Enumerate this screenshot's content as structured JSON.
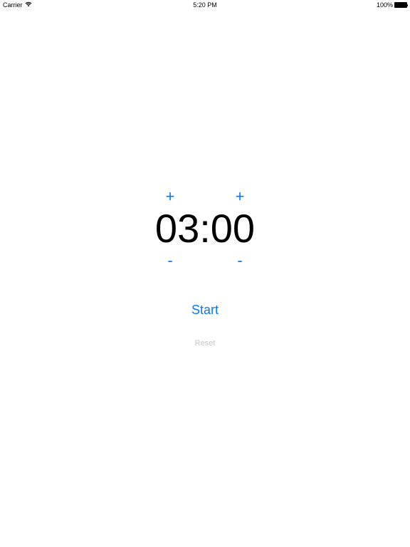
{
  "statusBar": {
    "carrier": "Carrier",
    "time": "5:20 PM",
    "battery": "100%"
  },
  "timer": {
    "plusMinutes": "+",
    "plusSeconds": "+",
    "display": "03:00",
    "minusMinutes": "-",
    "minusSeconds": "-"
  },
  "controls": {
    "start": "Start",
    "reset": "Reset"
  }
}
